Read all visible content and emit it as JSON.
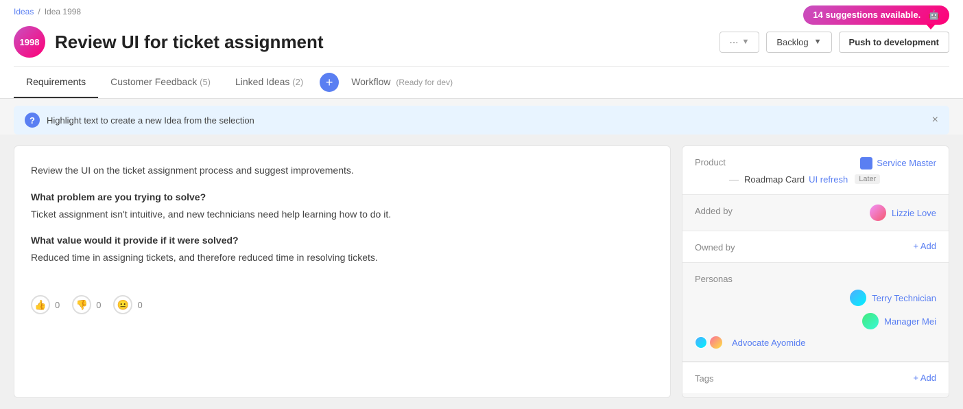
{
  "breadcrumb": {
    "ideas_label": "Ideas",
    "separator": "/",
    "current": "Idea 1998"
  },
  "idea": {
    "id": "1998",
    "title": "Review UI for ticket assignment",
    "description": "Review the UI on the ticket assignment process and suggest improvements.",
    "problem_title": "What problem are you trying to solve?",
    "problem_text": "Ticket assignment isn't intuitive, and new technicians need help learning how to do it.",
    "value_title": "What value would it provide if it were solved?",
    "value_text": "Reduced time in assigning tickets, and therefore reduced time in resolving tickets."
  },
  "votes": {
    "up": 0,
    "down": 0,
    "neutral": 0
  },
  "hint": {
    "icon": "?",
    "text": "Highlight text to create a new Idea from the selection",
    "close": "×"
  },
  "tabs": [
    {
      "label": "Requirements",
      "count": null,
      "active": true
    },
    {
      "label": "Customer Feedback",
      "count": 5,
      "active": false
    },
    {
      "label": "Linked Ideas",
      "count": 2,
      "active": false
    },
    {
      "label": "Workflow",
      "status": "Ready for dev",
      "active": false
    }
  ],
  "header_buttons": {
    "status_label": "···",
    "backlog_label": "Backlog",
    "push_label": "Push to development"
  },
  "suggestion": {
    "text": "14 suggestions available."
  },
  "sidebar": {
    "product_label": "Product",
    "product_name": "Service Master",
    "roadmap_label": "Roadmap Card",
    "roadmap_value": "UI refresh",
    "roadmap_timing": "Later",
    "added_by_label": "Added by",
    "added_by_name": "Lizzie Love",
    "owned_by_label": "Owned by",
    "owned_by_add": "+ Add",
    "personas_label": "Personas",
    "personas": [
      {
        "name": "Terry Technician",
        "avatar_class": "avatar-terry"
      },
      {
        "name": "Manager Mei",
        "avatar_class": "avatar-mei"
      },
      {
        "name": "Advocate Ayomide",
        "avatar_class": "avatar-ayomide"
      }
    ],
    "tags_label": "Tags",
    "tags_add": "+ Add"
  }
}
